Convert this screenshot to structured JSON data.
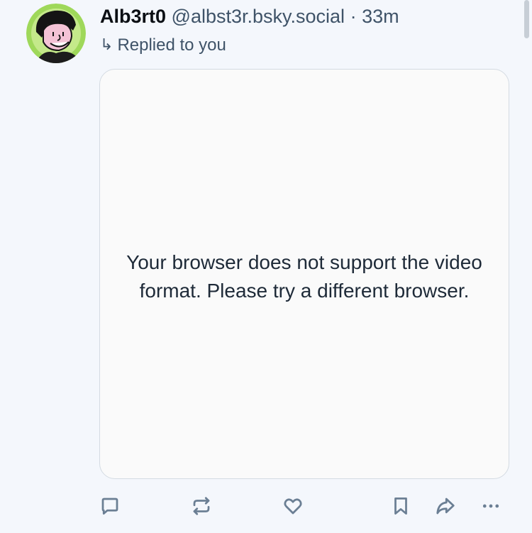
{
  "post": {
    "author": {
      "display_name": "Alb3rt0",
      "handle": "@albst3r.bsky.social",
      "avatar_icon": "cartoon-face-avatar"
    },
    "separator": "·",
    "timestamp": "33m",
    "reply_context": {
      "arrow": "↳",
      "text": "Replied to you"
    },
    "video": {
      "fallback_message": "Your browser does not support the video format. Please try a different browser."
    },
    "actions": [
      {
        "name": "reply-button",
        "icon": "speech-bubble-icon"
      },
      {
        "name": "repost-button",
        "icon": "repost-arrows-icon"
      },
      {
        "name": "like-button",
        "icon": "heart-icon"
      },
      {
        "name": "bookmark-button",
        "icon": "bookmark-icon"
      },
      {
        "name": "share-button",
        "icon": "share-arrow-icon"
      },
      {
        "name": "more-options-button",
        "icon": "ellipsis-icon"
      }
    ]
  },
  "colors": {
    "background": "#f4f7fc",
    "text_primary": "#0b0f14",
    "text_secondary": "#3f5368",
    "icon": "#6b7f94",
    "avatar_ring": "#a8dc5c"
  }
}
